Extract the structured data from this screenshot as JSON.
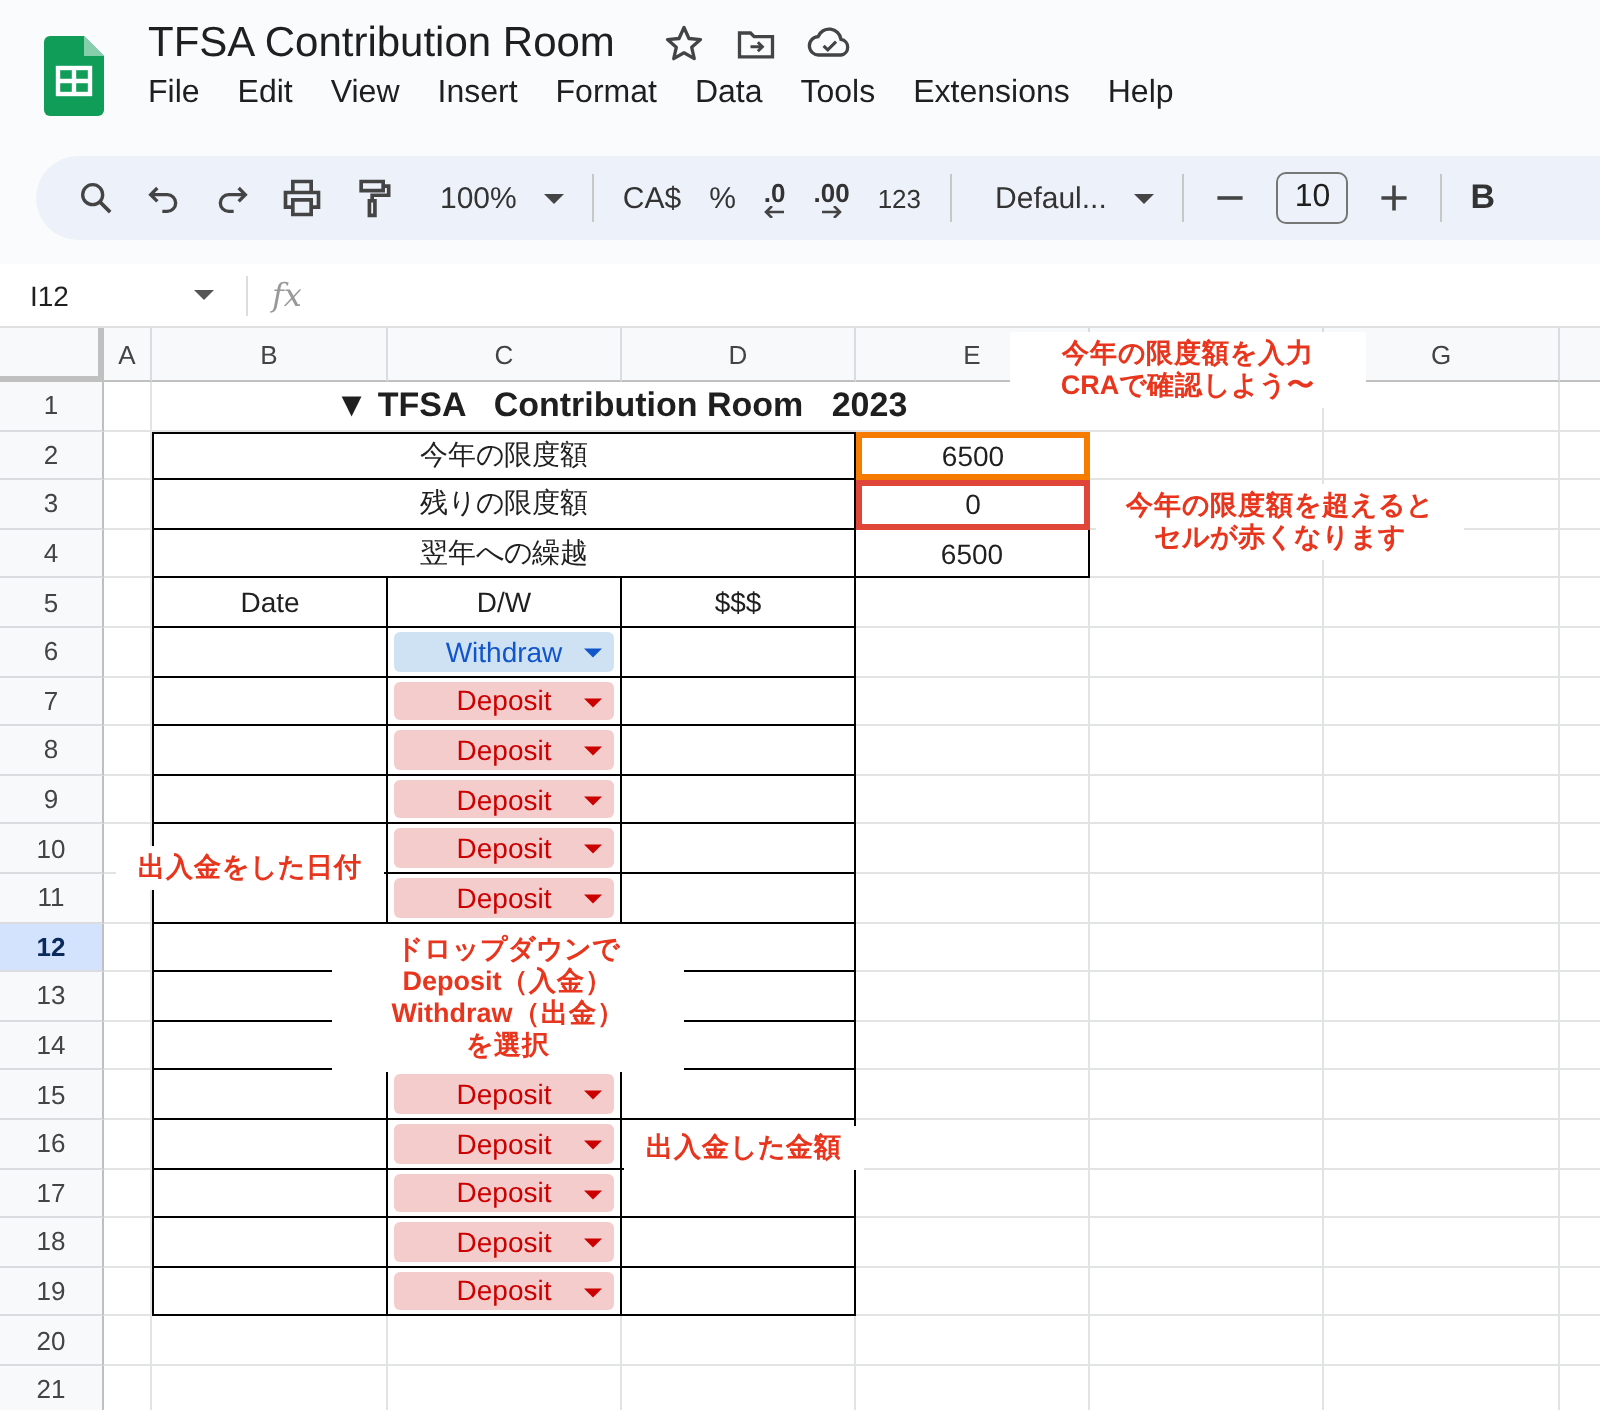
{
  "document": {
    "title": "TFSA Contribution Room"
  },
  "menu": [
    "File",
    "Edit",
    "View",
    "Insert",
    "Format",
    "Data",
    "Tools",
    "Extensions",
    "Help"
  ],
  "toolbar": {
    "zoom": "100%",
    "currency": "CA$",
    "percent": "%",
    "decrease_decimal": ".0",
    "increase_decimal": ".00",
    "number_format": "123",
    "font": "Defaul...",
    "font_size": "10",
    "bold": "B"
  },
  "formula_bar": {
    "name_box": "I12",
    "fx": "fx"
  },
  "sheet": {
    "columns": [
      "A",
      "B",
      "C",
      "D",
      "E"
    ],
    "last_column": "G",
    "rows": [
      {
        "number": "1",
        "selected": false
      },
      {
        "number": "2",
        "selected": false
      },
      {
        "number": "3",
        "selected": false
      },
      {
        "number": "4",
        "selected": false
      },
      {
        "number": "5",
        "selected": false
      },
      {
        "number": "6",
        "selected": false
      },
      {
        "number": "7",
        "selected": false
      },
      {
        "number": "8",
        "selected": false
      },
      {
        "number": "9",
        "selected": false
      },
      {
        "number": "10",
        "selected": false
      },
      {
        "number": "11",
        "selected": false
      },
      {
        "number": "12",
        "selected": true
      },
      {
        "number": "13",
        "selected": false
      },
      {
        "number": "14",
        "selected": false
      },
      {
        "number": "15",
        "selected": false
      },
      {
        "number": "16",
        "selected": false
      },
      {
        "number": "17",
        "selected": false
      },
      {
        "number": "18",
        "selected": false
      },
      {
        "number": "19",
        "selected": false
      },
      {
        "number": "20",
        "selected": false
      },
      {
        "number": "21",
        "selected": false
      }
    ],
    "title": "▼ TFSA   Contribution Room   2023",
    "summary": [
      {
        "label": "今年の限度額",
        "value": "6500",
        "color": "#f57c00"
      },
      {
        "label": "残りの限度額",
        "value": "0",
        "color": "#e0453a"
      },
      {
        "label": "翌年への繰越",
        "value": "6500"
      }
    ],
    "headers": [
      "Date",
      "D/W",
      "$$$"
    ],
    "entries": [
      {
        "kind": "dropdown",
        "dw": {
          "kind": "withdraw",
          "label": "Withdraw"
        }
      },
      {
        "kind": "dropdown",
        "dw": {
          "kind": "deposit",
          "label": "Deposit"
        }
      },
      {
        "kind": "dropdown",
        "dw": {
          "kind": "deposit",
          "label": "Deposit"
        }
      },
      {
        "kind": "dropdown",
        "dw": {
          "kind": "deposit",
          "label": "Deposit"
        }
      },
      {
        "kind": "dropdown",
        "dw": {
          "kind": "deposit",
          "label": "Deposit"
        }
      },
      {
        "kind": "dropdown",
        "dw": {
          "kind": "deposit",
          "label": "Deposit"
        }
      },
      {
        "kind": "blank"
      },
      {
        "kind": "blank"
      },
      {
        "kind": "blank"
      },
      {
        "kind": "dropdown",
        "dw": {
          "kind": "deposit",
          "label": "Deposit"
        }
      },
      {
        "kind": "dropdown",
        "dw": {
          "kind": "deposit",
          "label": "Deposit"
        }
      },
      {
        "kind": "dropdown",
        "dw": {
          "kind": "deposit",
          "label": "Deposit"
        }
      },
      {
        "kind": "dropdown",
        "dw": {
          "kind": "deposit",
          "label": "Deposit"
        }
      },
      {
        "kind": "dropdown",
        "dw": {
          "kind": "deposit",
          "label": "Deposit"
        }
      }
    ]
  },
  "callouts": [
    {
      "kind": "limit_input",
      "lines": [
        "今年の限度額を入力",
        "CRAで確認しよう〜"
      ]
    },
    {
      "kind": "limit_over",
      "lines": [
        "今年の限度額を超えると",
        "セルが赤くなります"
      ]
    },
    {
      "kind": "date",
      "lines": [
        "出入金をした日付"
      ]
    },
    {
      "kind": "dropdown",
      "lines": [
        "ドロップダウンで",
        "Deposit（入金）",
        "Withdraw（出金）",
        "を選択"
      ]
    },
    {
      "kind": "amount",
      "lines": [
        "出入金した金額"
      ]
    }
  ]
}
